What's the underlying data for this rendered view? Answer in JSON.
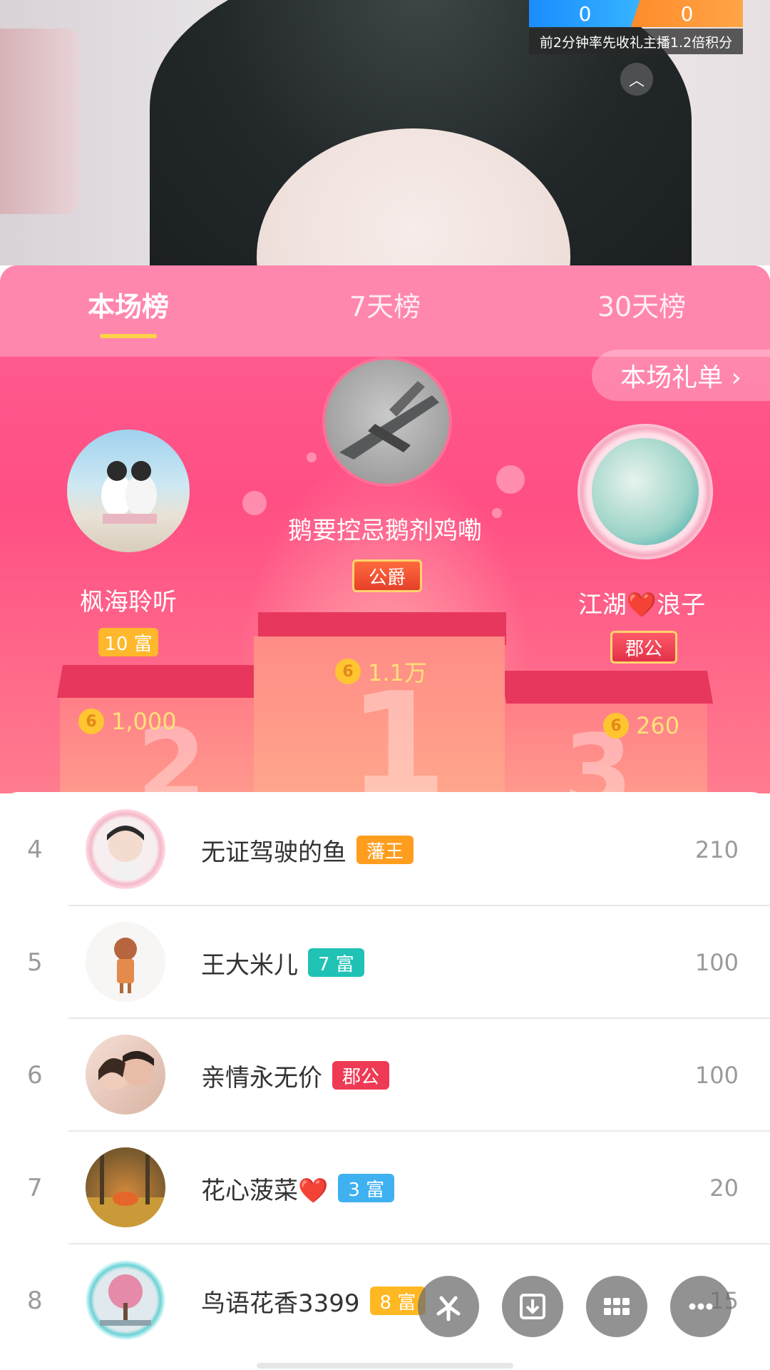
{
  "score": {
    "left": "0",
    "right": "0",
    "caption": "前2分钟率先收礼主播1.2倍积分"
  },
  "tabs": [
    {
      "label": "本场榜",
      "active": true
    },
    {
      "label": "7天榜",
      "active": false
    },
    {
      "label": "30天榜",
      "active": false
    }
  ],
  "gift_list_link": "本场礼单 ›",
  "coin_glyph": "6",
  "podium": {
    "first": {
      "name": "鹅要控忌鹅剂鸡嘞",
      "badge": "公爵",
      "coins": "1.1万",
      "num": "1"
    },
    "second": {
      "name": "枫海聆听",
      "badge": "10 富",
      "coins": "1,000",
      "num": "2"
    },
    "third": {
      "name": "江湖❤️浪子",
      "badge": "郡公",
      "coins": "260",
      "num": "3"
    }
  },
  "rows": [
    {
      "rank": "4",
      "name": "无证驾驶的鱼",
      "badge": "藩王",
      "badge_color": "#ff9d1f",
      "score": "210"
    },
    {
      "rank": "5",
      "name": "王大米儿",
      "badge": "7 富",
      "badge_color": "#1fc2b5",
      "score": "100"
    },
    {
      "rank": "6",
      "name": "亲情永无价",
      "badge": "郡公",
      "badge_color": "#ef3a55",
      "score": "100"
    },
    {
      "rank": "7",
      "name": "花心菠菜❤️",
      "badge": "3 富",
      "badge_color": "#3fb1f0",
      "score": "20"
    },
    {
      "rank": "8",
      "name": "鸟语花香3399",
      "badge": "8 富",
      "badge_color": "#ffb722",
      "score": "15"
    }
  ],
  "fabs": [
    "sparkle-icon",
    "download-icon",
    "grid-icon",
    "more-icon"
  ]
}
